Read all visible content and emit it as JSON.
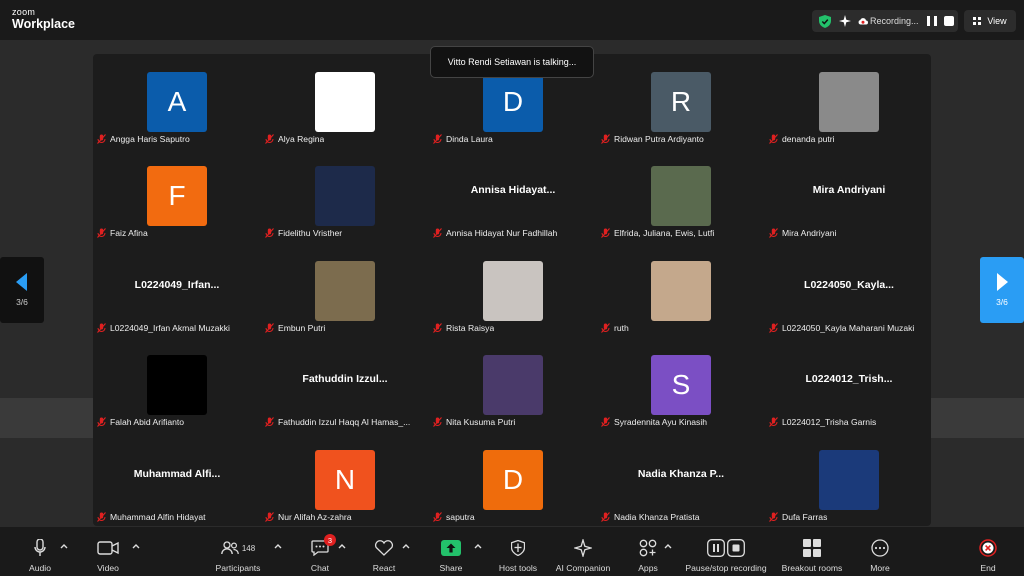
{
  "app": {
    "logo_top": "zoom",
    "logo_bottom": "Workplace"
  },
  "status": {
    "recording_text": "Recording...",
    "view_label": "View"
  },
  "talking_banner": "Vitto Rendi Setiawan is talking...",
  "pager": {
    "left_label": "3/6",
    "right_label": "3/6"
  },
  "participants": [
    {
      "name": "Angga Haris Saputro",
      "avatar_letter": "A",
      "avatar_color": "#0b5cab"
    },
    {
      "name": "Alya Regina",
      "avatar_letter": "",
      "avatar_color": "#ffffff"
    },
    {
      "name": "Dinda Laura",
      "avatar_letter": "D",
      "avatar_color": "#0b5cab"
    },
    {
      "name": "Ridwan Putra Ardiyanto",
      "avatar_letter": "R",
      "avatar_color": "#4a5a66"
    },
    {
      "name": "denanda putri",
      "avatar_letter": "",
      "avatar_color": "#8a8a8a"
    },
    {
      "name": "Faiz Afina",
      "avatar_letter": "F",
      "avatar_color": "#f26b10"
    },
    {
      "name": "Fidelithu Vristher",
      "avatar_letter": "",
      "avatar_color": "#1d2a4a"
    },
    {
      "name": "Annisa Hidayat Nur Fadhillah",
      "display_name": "Annisa  Hidayat..."
    },
    {
      "name": "Elfrida, Juliana, Ewis, Lutfi",
      "avatar_letter": "",
      "avatar_color": "#5a6a4e"
    },
    {
      "name": "Mira Andriyani",
      "display_name": "Mira Andriyani"
    },
    {
      "name": "L0224049_Irfan Akmal Muzakki",
      "display_name": "L0224049_Irfan..."
    },
    {
      "name": "Embun Putri",
      "avatar_letter": "",
      "avatar_color": "#7c6c4e"
    },
    {
      "name": "Rista Raisya",
      "avatar_letter": "",
      "avatar_color": "#c9c4c0"
    },
    {
      "name": "ruth",
      "avatar_letter": "",
      "avatar_color": "#c4a88c"
    },
    {
      "name": "L0224050_Kayla Maharani Muzaki",
      "display_name": "L0224050_Kayla..."
    },
    {
      "name": "Falah Abid Arifianto",
      "avatar_letter": "",
      "avatar_color": "#000000"
    },
    {
      "name": "Fathuddin Izzul Haqq Al Hamas_...",
      "display_name": "Fathuddin  Izzul..."
    },
    {
      "name": "Nita Kusuma Putri",
      "avatar_letter": "",
      "avatar_color": "#4a3a6a"
    },
    {
      "name": "Syradennita Ayu Kinasih",
      "avatar_letter": "S",
      "avatar_color": "#7b4fc4"
    },
    {
      "name": "L0224012_Trisha Garnis",
      "display_name": "L0224012_Trish..."
    },
    {
      "name": "Muhammad Alfin Hidayat",
      "display_name": "Muhammad  Alfi..."
    },
    {
      "name": "Nur Alifah Az-zahra",
      "avatar_letter": "N",
      "avatar_color": "#f0521e"
    },
    {
      "name": "saputra",
      "avatar_letter": "D",
      "avatar_color": "#ef6c0c"
    },
    {
      "name": "Nadia Khanza Pratista",
      "display_name": "Nadia  Khanza  P..."
    },
    {
      "name": "Dufa Farras",
      "avatar_letter": "",
      "avatar_color": "#1b3a7a"
    }
  ],
  "toolbar": {
    "audio": "Audio",
    "video": "Video",
    "participants": "Participants",
    "participants_count": "148",
    "chat": "Chat",
    "chat_badge": "3",
    "react": "React",
    "share": "Share",
    "host_tools": "Host tools",
    "ai_companion": "AI Companion",
    "apps": "Apps",
    "pause_recording": "Pause/stop recording",
    "breakout_rooms": "Breakout rooms",
    "more": "More",
    "end": "End"
  },
  "colors": {
    "share_green": "#23c16b",
    "end_red": "#e02020",
    "pager_blue": "#2a9df4"
  }
}
